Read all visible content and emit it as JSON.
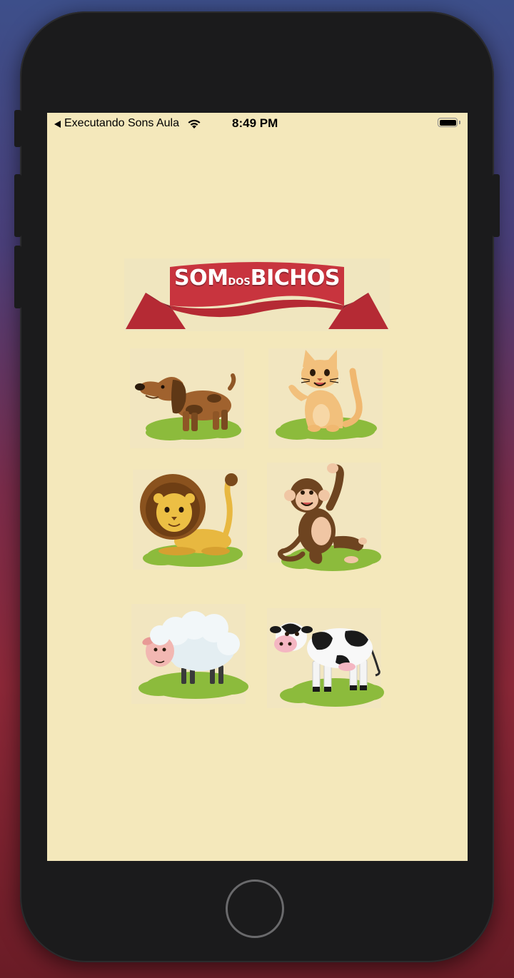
{
  "status_bar": {
    "back_app": "Executando Sons Aula",
    "time": "8:49 PM"
  },
  "logo": {
    "text_som": "SOM",
    "text_dos": "DOS",
    "text_bichos": "BICHOS"
  },
  "animals": [
    {
      "name": "dog",
      "icon": "dog-icon"
    },
    {
      "name": "cat",
      "icon": "cat-icon"
    },
    {
      "name": "lion",
      "icon": "lion-icon"
    },
    {
      "name": "monkey",
      "icon": "monkey-icon"
    },
    {
      "name": "sheep",
      "icon": "sheep-icon"
    },
    {
      "name": "cow",
      "icon": "cow-icon"
    }
  ],
  "colors": {
    "screen_background": "#f4e8bb",
    "banner_red": "#c8343e",
    "grass_green": "#8cbb3c"
  }
}
